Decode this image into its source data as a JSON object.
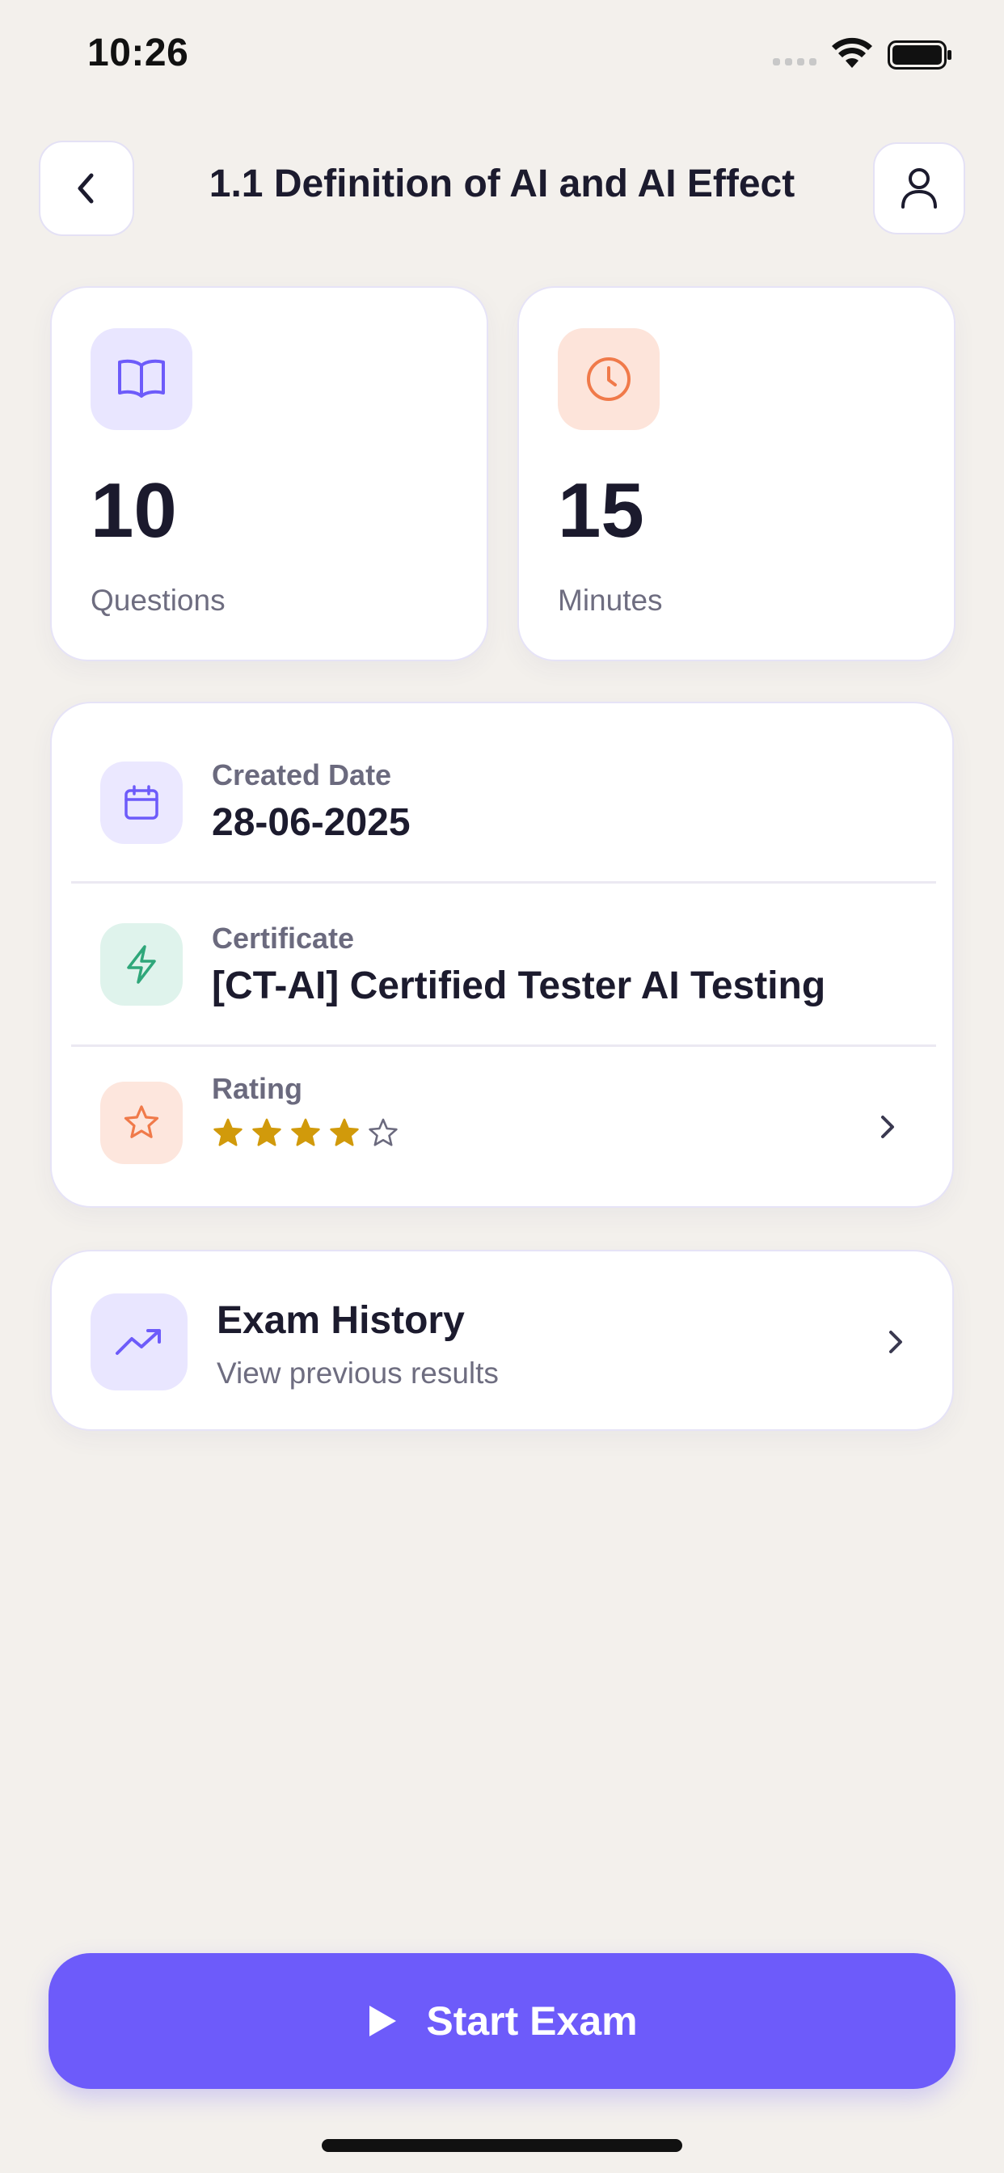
{
  "status_bar": {
    "time": "10:26"
  },
  "header": {
    "title": "1.1 Definition of AI and AI Effect"
  },
  "stats": [
    {
      "value": "10",
      "label": "Questions",
      "icon": "book-icon",
      "color": "#6d5bfa"
    },
    {
      "value": "15",
      "label": "Minutes",
      "icon": "clock-icon",
      "color": "#f07a4a"
    }
  ],
  "info": {
    "created": {
      "label": "Created Date",
      "value": "28-06-2025",
      "icon": "calendar-icon"
    },
    "certificate": {
      "label": "Certificate",
      "value": "[CT-AI] Certified Tester AI Testing",
      "icon": "lightning-icon"
    },
    "rating": {
      "label": "Rating",
      "stars_filled": 4,
      "stars_total": 5,
      "icon": "star-icon"
    }
  },
  "history": {
    "title": "Exam History",
    "subtitle": "View previous results",
    "icon": "trending-up-icon"
  },
  "start_button": {
    "label": "Start Exam"
  },
  "colors": {
    "accent": "#6d5bfa",
    "orange": "#f07a4a",
    "green": "#2fa77a",
    "star": "#d19a0b"
  }
}
